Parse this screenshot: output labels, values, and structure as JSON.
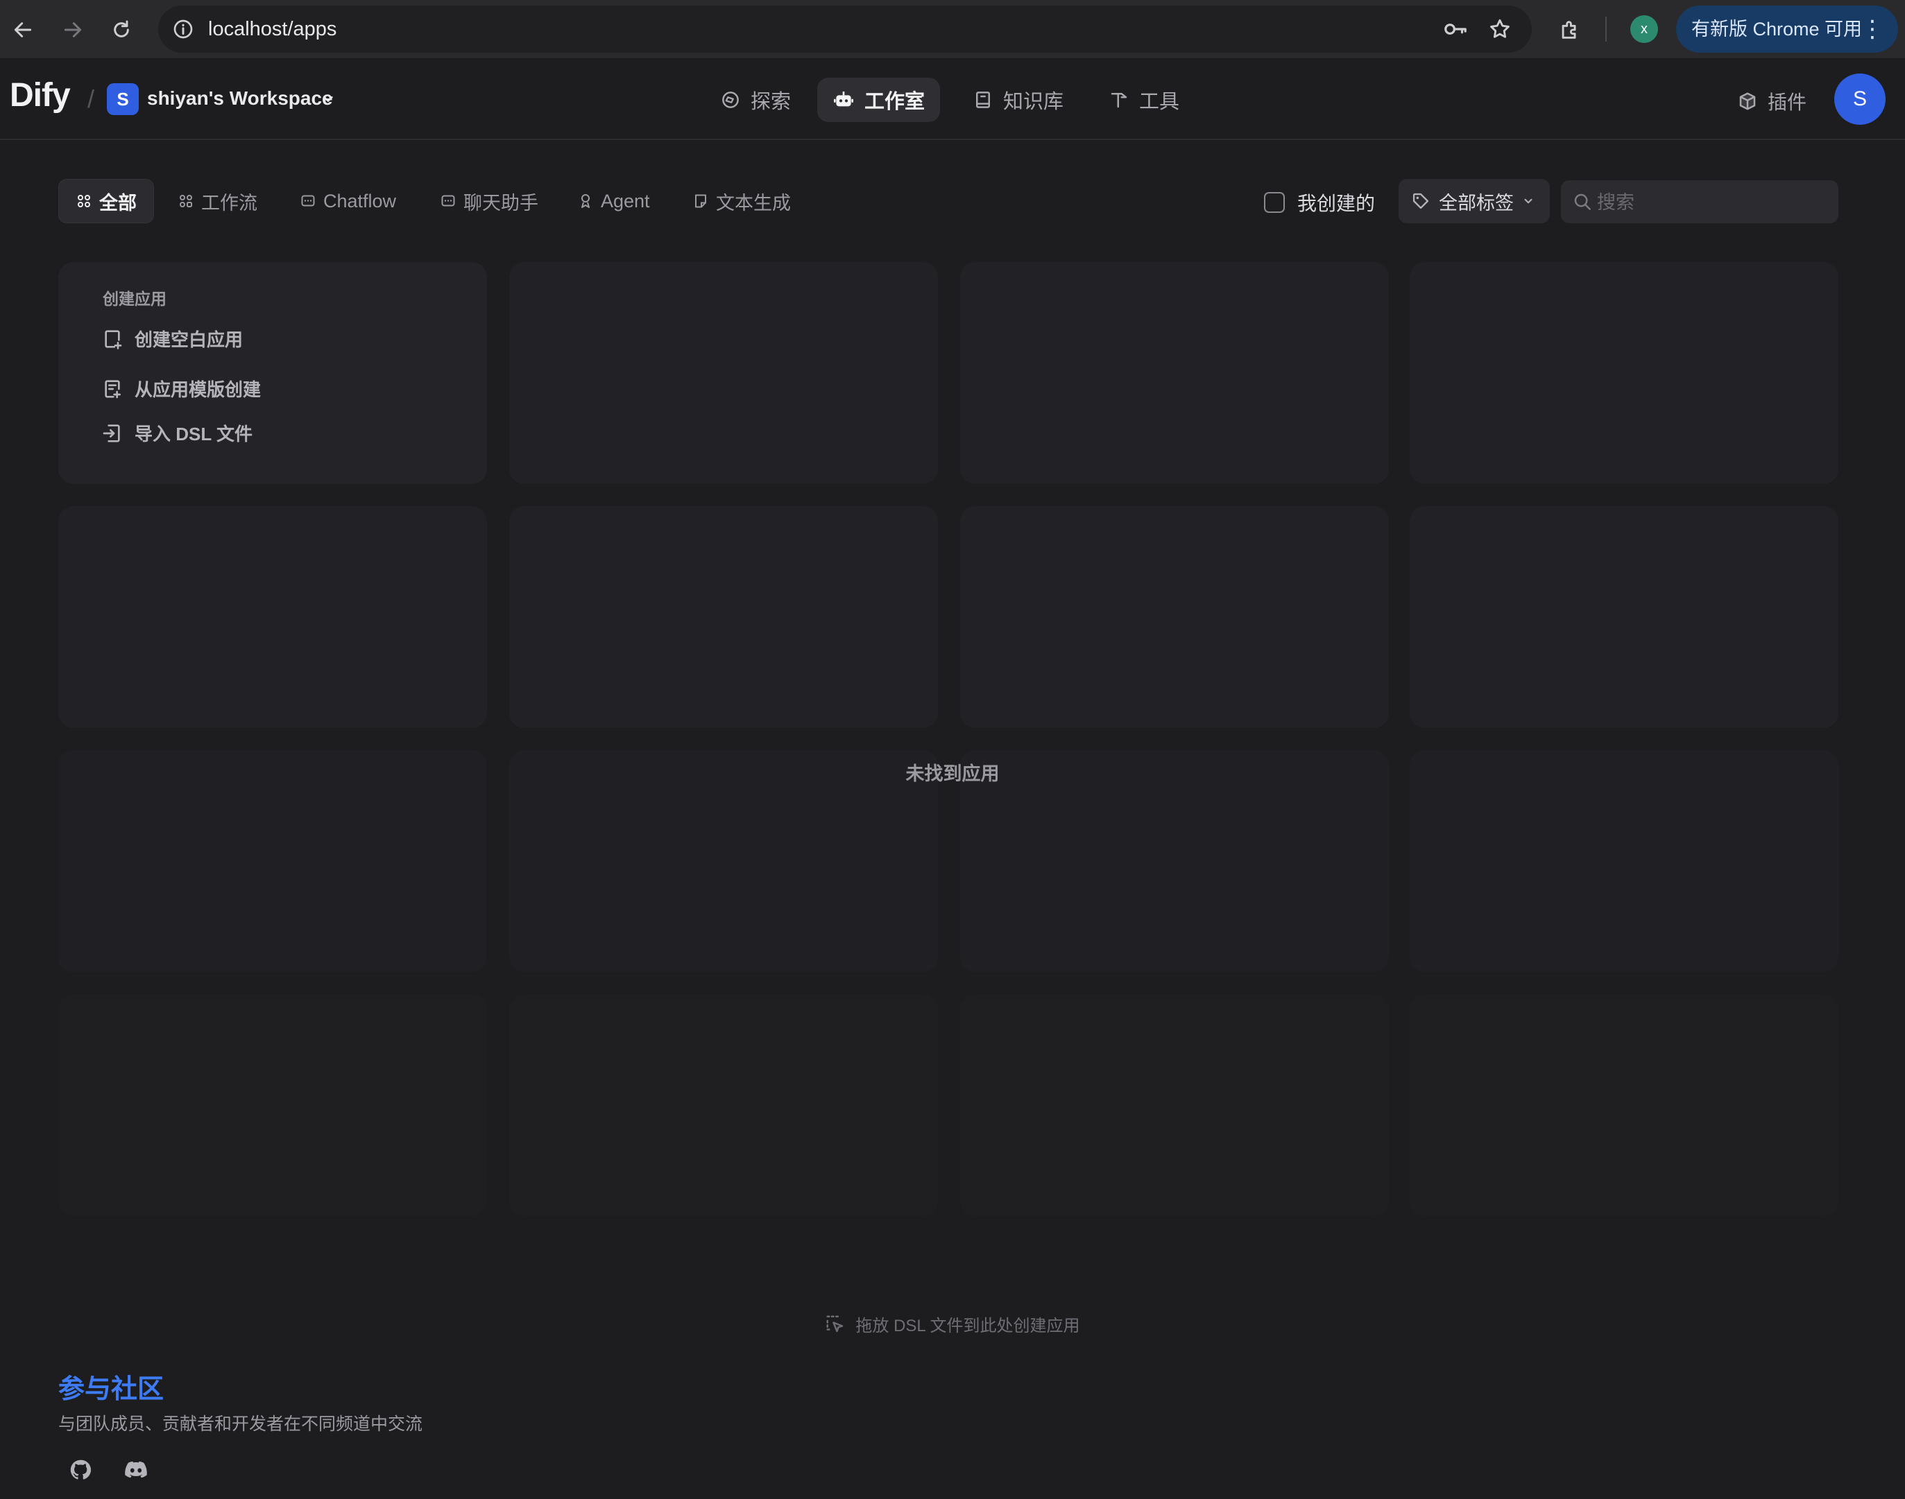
{
  "browser": {
    "url": "localhost/apps",
    "profile_initial": "x",
    "update_label": "有新版 Chrome 可用",
    "menu_glyph": "⋮"
  },
  "header": {
    "logo": "Dify",
    "workspace_initial": "S",
    "workspace_name": "shiyan's Workspace",
    "nav": {
      "explore": "探索",
      "studio": "工作室",
      "knowledge": "知识库",
      "tools": "工具"
    },
    "plugins": "插件",
    "user_initial": "S"
  },
  "filters": {
    "tabs": {
      "all": "全部",
      "workflow": "工作流",
      "chatflow": "Chatflow",
      "chat": "聊天助手",
      "agent": "Agent",
      "completion": "文本生成"
    },
    "my_created": "我创建的",
    "tags": "全部标签",
    "search_placeholder": "搜索"
  },
  "create_card": {
    "title": "创建应用",
    "blank": "创建空白应用",
    "template": "从应用模版创建",
    "import": "导入 DSL 文件"
  },
  "empty_message": "未找到应用",
  "dsl_hint": "拖放 DSL 文件到此处创建应用",
  "community": {
    "title": "参与社区",
    "subtitle": "与团队成员、贡献者和开发者在不同频道中交流"
  },
  "colors": {
    "accent": "#3d7cf5",
    "avatar": "#2f5ee0",
    "background": "#1d1d20"
  }
}
